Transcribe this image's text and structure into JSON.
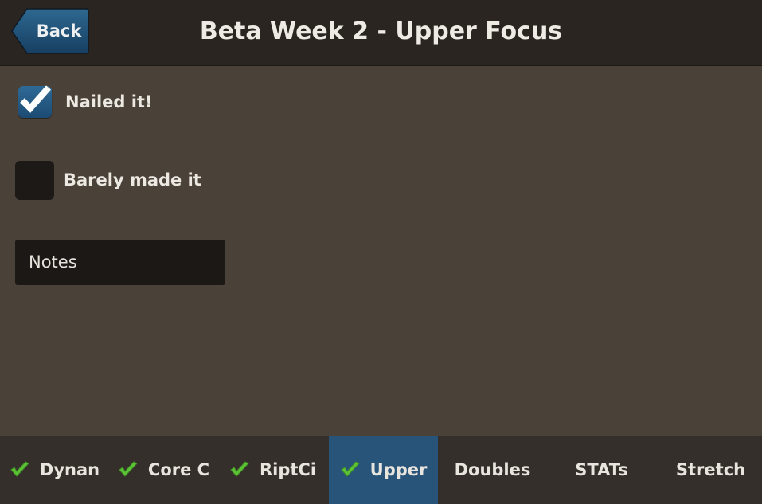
{
  "header": {
    "back_label": "Back",
    "title": "Beta Week 2 - Upper Focus"
  },
  "options": [
    {
      "label": "Nailed it!",
      "checked": true
    },
    {
      "label": "Barely made it",
      "checked": false
    }
  ],
  "notes": {
    "placeholder": "Notes",
    "value": ""
  },
  "tabs": [
    {
      "label": "Dynan",
      "completed": true,
      "active": false
    },
    {
      "label": "Core C",
      "completed": true,
      "active": false
    },
    {
      "label": "RiptCi",
      "completed": true,
      "active": false
    },
    {
      "label": "Upper",
      "completed": true,
      "active": true
    },
    {
      "label": "Doubles",
      "completed": false,
      "active": false
    },
    {
      "label": "STATs",
      "completed": false,
      "active": false
    },
    {
      "label": "Stretch",
      "completed": false,
      "active": false
    }
  ],
  "colors": {
    "accent": "#285479",
    "check_green": "#5cc236",
    "header_bg": "#2a2521",
    "content_bg": "#4a4238",
    "tabbar_bg": "#342f2a"
  }
}
